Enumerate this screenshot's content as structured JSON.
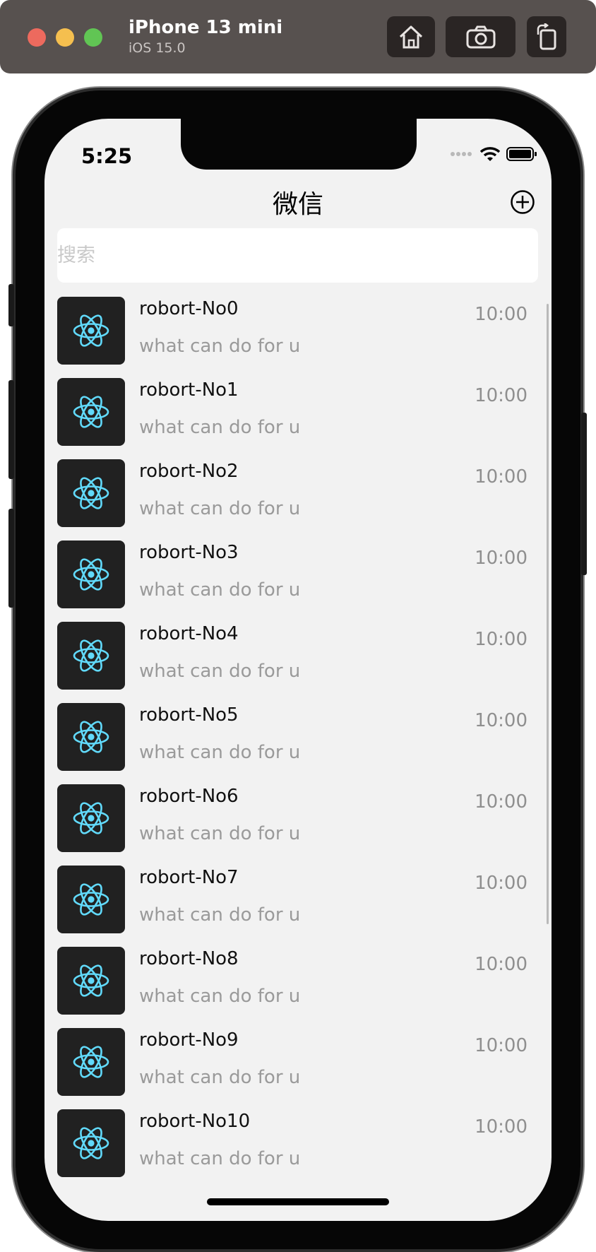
{
  "simulator": {
    "device_name": "iPhone 13 mini",
    "os_version": "iOS 15.0",
    "buttons": [
      "home-icon",
      "screenshot-icon",
      "rotate-icon"
    ]
  },
  "status_bar": {
    "time": "5:25"
  },
  "nav": {
    "title": "微信",
    "action_icon": "plus-circle-icon"
  },
  "search": {
    "placeholder": "搜索",
    "value": ""
  },
  "chats": [
    {
      "name": "robort-No0",
      "message": "what can do for u",
      "time": "10:00"
    },
    {
      "name": "robort-No1",
      "message": "what can do for u",
      "time": "10:00"
    },
    {
      "name": "robort-No2",
      "message": "what can do for u",
      "time": "10:00"
    },
    {
      "name": "robort-No3",
      "message": "what can do for u",
      "time": "10:00"
    },
    {
      "name": "robort-No4",
      "message": "what can do for u",
      "time": "10:00"
    },
    {
      "name": "robort-No5",
      "message": "what can do for u",
      "time": "10:00"
    },
    {
      "name": "robort-No6",
      "message": "what can do for u",
      "time": "10:00"
    },
    {
      "name": "robort-No7",
      "message": "what can do for u",
      "time": "10:00"
    },
    {
      "name": "robort-No8",
      "message": "what can do for u",
      "time": "10:00"
    },
    {
      "name": "robort-No9",
      "message": "what can do for u",
      "time": "10:00"
    },
    {
      "name": "robort-No10",
      "message": "what can do for u",
      "time": "10:00"
    }
  ],
  "colors": {
    "toolbar_bg": "#57514f",
    "screen_bg": "#f2f2f2",
    "avatar_bg": "#212121",
    "react_logo": "#61dafb"
  }
}
